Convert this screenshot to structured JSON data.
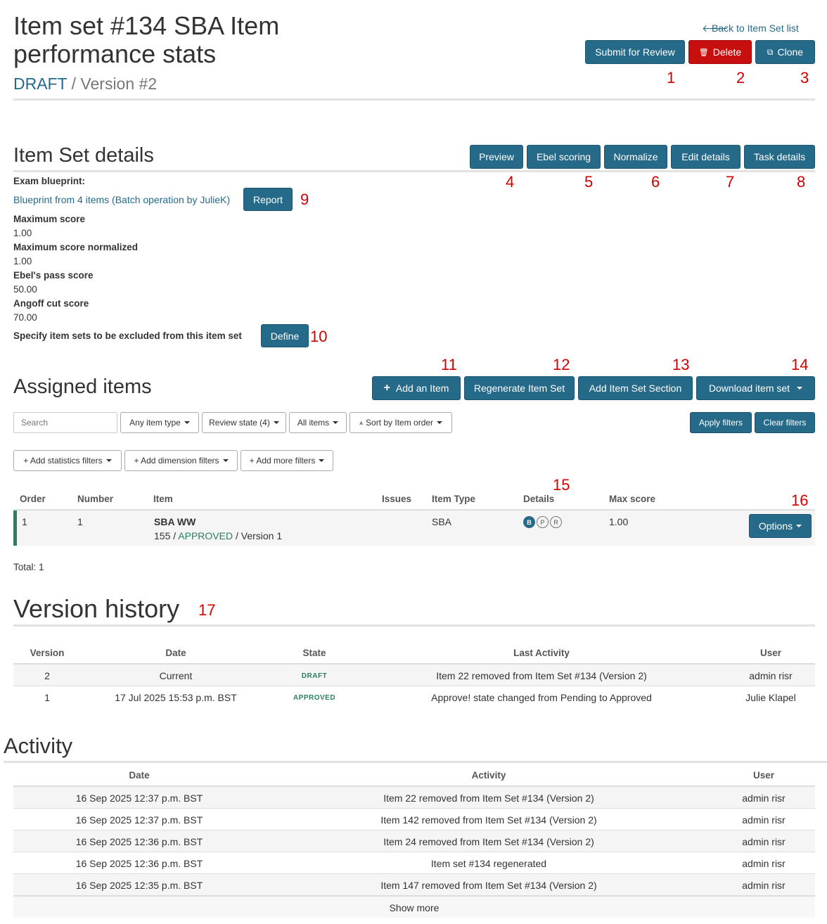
{
  "header": {
    "title_line1": "Item set #134 SBA Item",
    "title_line2": "performance stats",
    "state": "DRAFT",
    "version": " / Version #2",
    "back_link": "Back to Item Set list"
  },
  "top_buttons": {
    "submit": "Submit for Review",
    "delete": "Delete",
    "clone": "Clone"
  },
  "annotations": [
    "1",
    "2",
    "3",
    "4",
    "5",
    "6",
    "7",
    "8",
    "9",
    "10",
    "11",
    "12",
    "13",
    "14",
    "15",
    "16",
    "17"
  ],
  "details": {
    "heading": "Item Set details",
    "buttons": {
      "preview": "Preview",
      "ebel": "Ebel scoring",
      "normalize": "Normalize",
      "edit": "Edit details",
      "task": "Task details"
    },
    "blueprint_label": "Exam blueprint:",
    "blueprint_link": "Blueprint from 4 items (Batch operation by JulieK)",
    "report_btn": "Report",
    "max_score_label": "Maximum score",
    "max_score": "1.00",
    "max_norm_label": "Maximum score normalized",
    "max_norm": "1.00",
    "ebel_label": "Ebel's pass score",
    "ebel": "50.00",
    "angoff_label": "Angoff cut score",
    "angoff": "70.00",
    "exclude_label": "Specify item sets to be excluded from this item set",
    "define_btn": "Define"
  },
  "assigned": {
    "heading": "Assigned items",
    "buttons": {
      "add": "Add an Item",
      "regen": "Regenerate Item Set",
      "section": "Add Item Set Section",
      "download": "Download item set"
    },
    "search_placeholder": "Search",
    "filters": {
      "item_type": "Any item type",
      "review_state": "Review state (4)",
      "all_items": "All items",
      "sort": "Sort by Item order",
      "apply": "Apply filters",
      "clear": "Clear filters",
      "stats": "+ Add statistics filters",
      "dimension": "+ Add dimension filters",
      "more": "+ Add more filters"
    },
    "columns": [
      "Order",
      "Number",
      "Item",
      "Issues",
      "Item Type",
      "Details",
      "Max score"
    ],
    "row": {
      "order": "1",
      "number": "1",
      "item_name": "SBA WW",
      "item_id": "155 / ",
      "item_state": "APPROVED",
      "item_version": " / Version 1",
      "type": "SBA",
      "badges": [
        "B",
        "P",
        "R"
      ],
      "max_score": "1.00",
      "options": "Options"
    },
    "total": "Total: 1"
  },
  "versions": {
    "heading": "Version history",
    "columns": [
      "Version",
      "Date",
      "State",
      "Last Activity",
      "User"
    ],
    "rows": [
      {
        "version": "2",
        "date": "Current",
        "state": "DRAFT",
        "activity": "Item 22 removed from Item Set #134 (Version 2)",
        "user": "admin risr"
      },
      {
        "version": "1",
        "date": "17 Jul 2025 15:53 p.m. BST",
        "state": "APPROVED",
        "activity": "Approve! state changed from Pending to Approved",
        "user": "Julie Klapel"
      }
    ]
  },
  "activity": {
    "heading": "Activity",
    "columns": [
      "Date",
      "Activity",
      "User"
    ],
    "rows": [
      {
        "date": "16 Sep 2025 12:37 p.m. BST",
        "activity": "Item 22 removed from Item Set #134 (Version 2)",
        "user": "admin risr"
      },
      {
        "date": "16 Sep 2025 12:37 p.m. BST",
        "activity": "Item 142 removed from Item Set #134 (Version 2)",
        "user": "admin risr"
      },
      {
        "date": "16 Sep 2025 12:36 p.m. BST",
        "activity": "Item 24 removed from Item Set #134 (Version 2)",
        "user": "admin risr"
      },
      {
        "date": "16 Sep 2025 12:36 p.m. BST",
        "activity": "Item set #134 regenerated",
        "user": "admin risr"
      },
      {
        "date": "16 Sep 2025 12:35 p.m. BST",
        "activity": "Item 147 removed from Item Set #134 (Version 2)",
        "user": "admin risr"
      }
    ],
    "show_more": "Show more"
  }
}
